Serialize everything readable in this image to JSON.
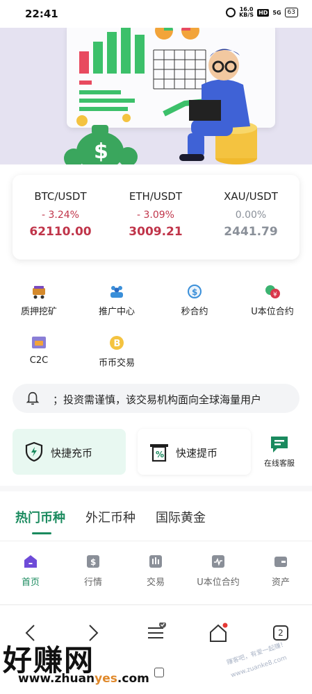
{
  "status_bar": {
    "time": "22:41",
    "net_speed_value": "16.0",
    "net_speed_unit": "KB/S",
    "hd": "HD",
    "signal": "5G",
    "battery": "63"
  },
  "banner": {
    "illustration": "person-with-laptop-on-coins-chart-board"
  },
  "tickers": [
    {
      "pair": "BTC/USDT",
      "change": "- 3.24%",
      "price": "62110.00",
      "trend": "down"
    },
    {
      "pair": "ETH/USDT",
      "change": "- 3.09%",
      "price": "3009.21",
      "trend": "down"
    },
    {
      "pair": "XAU/USDT",
      "change": "0.00%",
      "price": "2441.79",
      "trend": "flat"
    }
  ],
  "quick_menu": [
    {
      "label": "质押挖矿",
      "icon": "mining-cart-icon"
    },
    {
      "label": "推广中心",
      "icon": "team-icon"
    },
    {
      "label": "秒合约",
      "icon": "timer-contract-icon"
    },
    {
      "label": "U本位合约",
      "icon": "currency-exchange-icon"
    },
    {
      "label": "C2C",
      "icon": "c2c-icon"
    },
    {
      "label": "币币交易",
      "icon": "bitcoin-coin-icon"
    }
  ],
  "notice": {
    "text": "；投资需谨慎，该交易机构面向全球海量用户"
  },
  "actions": {
    "deposit_label": "快捷充币",
    "withdraw_label": "快速提币",
    "service_label": "在线客服"
  },
  "market_tabs": [
    {
      "label": "热门币种",
      "active": true
    },
    {
      "label": "外汇币种",
      "active": false
    },
    {
      "label": "国际黄金",
      "active": false
    }
  ],
  "bottom_nav": [
    {
      "label": "首页",
      "icon": "home-icon",
      "active": true
    },
    {
      "label": "行情",
      "icon": "market-icon",
      "active": false
    },
    {
      "label": "交易",
      "icon": "trade-icon",
      "active": false
    },
    {
      "label": "U本位合约",
      "icon": "contract-icon",
      "active": false
    },
    {
      "label": "资产",
      "icon": "wallet-icon",
      "active": false
    }
  ],
  "browser_bar": {
    "tab_count": "2"
  },
  "watermark": {
    "logo_text": "好赚网",
    "url_before": "www.zhuan",
    "url_accent": "yes",
    "url_after": ".com",
    "stamp_text": "赚客吧，有爱一起赚！ www.zuanke8.com"
  },
  "colors": {
    "accent_green": "#1a8a5e",
    "negative_red": "#c0354a",
    "neutral_gray": "#8a9099",
    "banner_bg": "#e5e2f1"
  }
}
